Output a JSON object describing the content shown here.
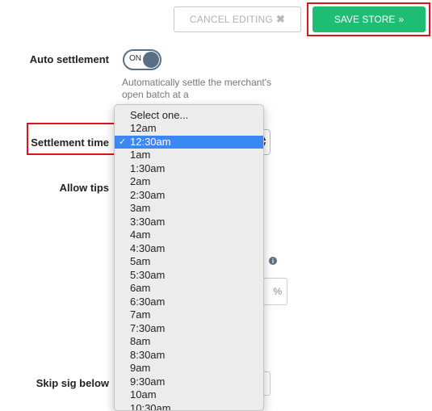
{
  "toolbar": {
    "cancel_label": "CANCEL EDITING",
    "cancel_icon": "✖",
    "save_label": "SAVE STORE",
    "save_icon": "»"
  },
  "auto_settlement": {
    "label": "Auto settlement",
    "toggle_text": "ON",
    "helper": "Automatically settle the merchant's open batch at a"
  },
  "settlement_time": {
    "label": "Settlement time",
    "placeholder": "Select one...",
    "options": [
      "12am",
      "12:30am",
      "1am",
      "1:30am",
      "2am",
      "2:30am",
      "3am",
      "3:30am",
      "4am",
      "4:30am",
      "5am",
      "5:30am",
      "6am",
      "6:30am",
      "7am",
      "7:30am",
      "8am",
      "8:30am",
      "9am",
      "9:30am",
      "10am",
      "10:30am"
    ],
    "selected": "12:30am",
    "check": "✓"
  },
  "allow_tips": {
    "label": "Allow tips",
    "percent_symbol": "%",
    "info_icon": "i"
  },
  "skip_sig": {
    "label": "Skip sig below"
  },
  "colors": {
    "accent_green": "#1fbc73",
    "highlight_red": "#e0131c",
    "select_blue": "#3a87f5",
    "toggle": "#5a6f86"
  }
}
